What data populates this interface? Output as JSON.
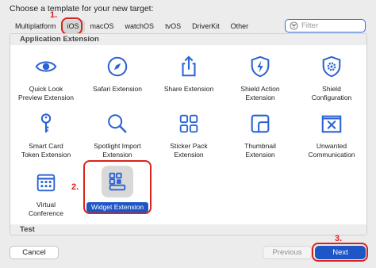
{
  "title": "Choose a template for your new target:",
  "tabs": [
    "Multiplatform",
    "iOS",
    "macOS",
    "watchOS",
    "tvOS",
    "DriverKit",
    "Other"
  ],
  "filter": {
    "placeholder": "Filter"
  },
  "sections": {
    "app_extension": "Application Extension",
    "test": "Test"
  },
  "templates": {
    "quick_look": "Quick Look\nPreview Extension",
    "safari": "Safari Extension",
    "share": "Share Extension",
    "shield_action": "Shield Action\nExtension",
    "shield_config": "Shield\nConfiguration",
    "smart_card": "Smart Card\nToken Extension",
    "spotlight": "Spotlight Import\nExtension",
    "sticker": "Sticker Pack\nExtension",
    "thumbnail": "Thumbnail\nExtension",
    "unwanted": "Unwanted\nCommunication",
    "virtual_conf": "Virtual\nConference",
    "widget": "Widget Extension"
  },
  "annotations": {
    "step1": "1.",
    "step2": "2.",
    "step3": "3."
  },
  "buttons": {
    "cancel": "Cancel",
    "previous": "Previous",
    "next": "Next"
  },
  "colors": {
    "accent": "#1f56c6",
    "annotation": "#d8241c",
    "icon": "#2b63d4"
  }
}
